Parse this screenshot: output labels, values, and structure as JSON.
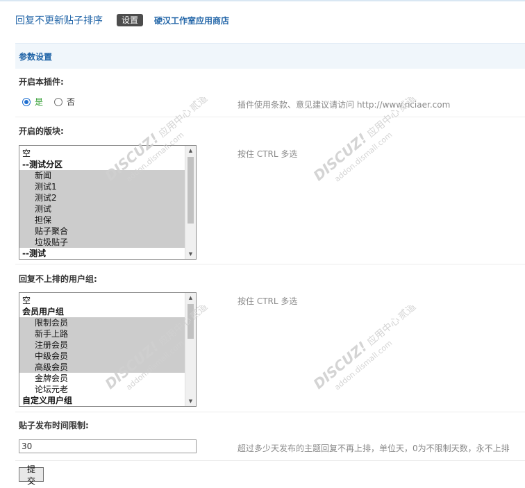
{
  "header": {
    "plugin_title": "回复不更新贴子排序",
    "active_tab": "设置",
    "store_link": "硬汉工作室应用商店"
  },
  "section": {
    "title": "参数设置"
  },
  "enable_plugin": {
    "label": "开启本插件:",
    "options": [
      {
        "label": "是",
        "checked": true
      },
      {
        "label": "否",
        "checked": false
      }
    ],
    "hint": "插件使用条款、意见建议请访问 http://www.nciaer.com"
  },
  "forums": {
    "label": "开启的版块:",
    "hint": "按住 CTRL 多选",
    "options": [
      {
        "label": "空",
        "type": "item",
        "selected": false
      },
      {
        "label": "--测试分区",
        "type": "group",
        "selected": false
      },
      {
        "label": "新闻",
        "type": "sub",
        "selected": true
      },
      {
        "label": "测试1",
        "type": "sub",
        "selected": true
      },
      {
        "label": "测试2",
        "type": "sub",
        "selected": true
      },
      {
        "label": "测试",
        "type": "sub",
        "selected": true
      },
      {
        "label": "担保",
        "type": "sub",
        "selected": true
      },
      {
        "label": "贴子聚合",
        "type": "sub",
        "selected": true
      },
      {
        "label": "垃圾贴子",
        "type": "sub",
        "selected": true
      },
      {
        "label": "--测试",
        "type": "group",
        "selected": false
      }
    ]
  },
  "usergroups": {
    "label": "回复不上排的用户组:",
    "hint": "按住 CTRL 多选",
    "options": [
      {
        "label": "空",
        "type": "item",
        "selected": false
      },
      {
        "label": "会员用户组",
        "type": "group",
        "selected": false
      },
      {
        "label": "限制会员",
        "type": "sub",
        "selected": true
      },
      {
        "label": "新手上路",
        "type": "sub",
        "selected": true
      },
      {
        "label": "注册会员",
        "type": "sub",
        "selected": true
      },
      {
        "label": "中级会员",
        "type": "sub",
        "selected": true
      },
      {
        "label": "高级会员",
        "type": "sub",
        "selected": true
      },
      {
        "label": "金牌会员",
        "type": "sub",
        "selected": false
      },
      {
        "label": "论坛元老",
        "type": "sub",
        "selected": false
      },
      {
        "label": "自定义用户组",
        "type": "group",
        "selected": false
      }
    ]
  },
  "time_limit": {
    "label": "贴子发布时间限制:",
    "value": "30",
    "hint": "超过多少天发布的主题回复不再上排，单位天，0为不限制天数，永不上排"
  },
  "submit_label": "提交",
  "watermark": {
    "brand": "DISCUZ!",
    "cn": "应用中心",
    "url": "addon.dismall.com",
    "mark": "贰道"
  }
}
